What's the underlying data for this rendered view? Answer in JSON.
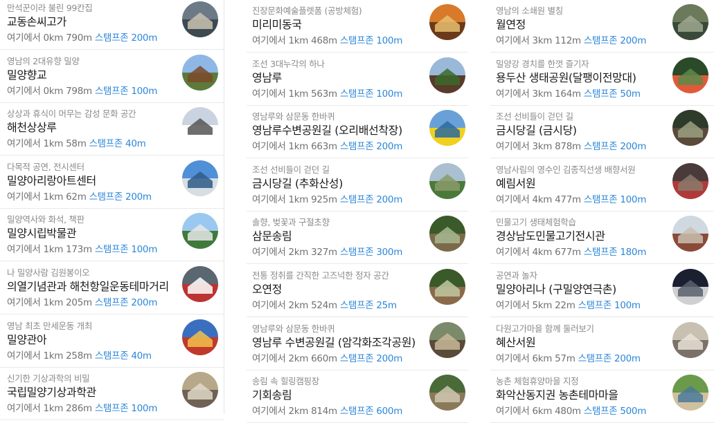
{
  "labels": {
    "from_here": "여기에서",
    "stamp_zone": "스탬프존"
  },
  "columns": [
    {
      "items": [
        {
          "subtitle": "만석꾼이라 불린 99칸집",
          "name": "교동손씨고가",
          "distance": "0km 790m",
          "stamp_radius": "200m",
          "icon": "hanok-house-photo"
        },
        {
          "subtitle": "영남의 2대유향 밀양",
          "name": "밀양향교",
          "distance": "0km 798m",
          "stamp_radius": "100m",
          "icon": "confucian-school-photo"
        },
        {
          "subtitle": "상상과 휴식이 머무는 감성 문화 공간",
          "name": "해천상상루",
          "distance": "1km 58m",
          "stamp_radius": "40m",
          "icon": "culture-building-photo"
        },
        {
          "subtitle": "다목적 공연, 전시센터",
          "name": "밀양아리랑아트센터",
          "distance": "1km 62m",
          "stamp_radius": "200m",
          "icon": "art-center-photo"
        },
        {
          "subtitle": "밀양역사와 화석, 책판",
          "name": "밀양시립박물관",
          "distance": "1km 173m",
          "stamp_radius": "100m",
          "icon": "museum-photo"
        },
        {
          "subtitle": "나 밀양사람 김원봉이오",
          "name": "의열기념관과 해천항일운동테마거리",
          "distance": "1km 205m",
          "stamp_radius": "200m",
          "icon": "memorial-street-photo"
        },
        {
          "subtitle": "영남 최초 만세운동 개최",
          "name": "밀양관아",
          "distance": "1km 258m",
          "stamp_radius": "40m",
          "icon": "government-office-photo"
        },
        {
          "subtitle": "신기한 기상과학의 비밀",
          "name": "국립밀양기상과학관",
          "distance": "1km 286m",
          "stamp_radius": "100m",
          "icon": "science-museum-photo"
        }
      ]
    },
    {
      "items": [
        {
          "subtitle": "진장문화예술플렛폼 (공방체험)",
          "name": "미리미동국",
          "distance": "1km 468m",
          "stamp_radius": "100m",
          "icon": "craft-platform-photo"
        },
        {
          "subtitle": "조선 3대누각의 하나",
          "name": "영남루",
          "distance": "1km 563m",
          "stamp_radius": "100m",
          "icon": "pavilion-photo"
        },
        {
          "subtitle": "영남루와 삼문동 한바퀴",
          "name": "영남루수변공원길 (오리배선착장)",
          "distance": "1km 663m",
          "stamp_radius": "200m",
          "icon": "duck-boat-photo"
        },
        {
          "subtitle": "조선 선비들이 걷던 길",
          "name": "금시당길 (추화산성)",
          "distance": "1km 925m",
          "stamp_radius": "200m",
          "icon": "mountain-fortress-photo"
        },
        {
          "subtitle": "솔향, 벚꽃과 구절초향",
          "name": "삼문송림",
          "distance": "2km 327m",
          "stamp_radius": "300m",
          "icon": "pine-forest-photo"
        },
        {
          "subtitle": "전통 정취를 간직한 고즈넉한 정자 공간",
          "name": "오연정",
          "distance": "2km 524m",
          "stamp_radius": "25m",
          "icon": "pavilion-garden-photo"
        },
        {
          "subtitle": "영남루와 삼문동 한바퀴",
          "name": "영남루 수변공원길 (암각화조각공원)",
          "distance": "2km 660m",
          "stamp_radius": "200m",
          "icon": "sculpture-park-photo"
        },
        {
          "subtitle": "송림 속 힐링캠핑장",
          "name": "기회송림",
          "distance": "2km 814m",
          "stamp_radius": "600m",
          "icon": "campsite-photo"
        }
      ]
    },
    {
      "items": [
        {
          "subtitle": "영남의 소쇄원 별칭",
          "name": "월연정",
          "distance": "3km 112m",
          "stamp_radius": "200m",
          "icon": "garden-pavilion-photo"
        },
        {
          "subtitle": "밀양강 경치를 한껏 즐기자",
          "name": "용두산 생태공원(달팽이전망대)",
          "distance": "3km 164m",
          "stamp_radius": "50m",
          "icon": "eco-park-map-photo"
        },
        {
          "subtitle": "조선 선비들이 걷던 길",
          "name": "금시당길 (금시당)",
          "distance": "3km 878m",
          "stamp_radius": "200m",
          "icon": "old-house-photo"
        },
        {
          "subtitle": "영남사림의 영수인 김종직선생 배향서원",
          "name": "예림서원",
          "distance": "4km 477m",
          "stamp_radius": "100m",
          "icon": "seowon-gate-photo"
        },
        {
          "subtitle": "민물고기 생태체험학습",
          "name": "경상남도민물고기전시관",
          "distance": "4km 677m",
          "stamp_radius": "180m",
          "icon": "aquarium-building-photo"
        },
        {
          "subtitle": "공연과 놀자",
          "name": "밀양아리나 (구밀양연극촌)",
          "distance": "5km 22m",
          "stamp_radius": "100m",
          "icon": "theater-night-photo"
        },
        {
          "subtitle": "다원고가마을 함께 둘러보기",
          "name": "혜산서원",
          "distance": "6km 57m",
          "stamp_radius": "200m",
          "icon": "stone-sign-photo"
        },
        {
          "subtitle": "농촌 체험휴양마을 지정",
          "name": "화악산동지권 농촌테마마을",
          "distance": "6km 480m",
          "stamp_radius": "500m",
          "icon": "village-map-photo"
        }
      ]
    }
  ]
}
